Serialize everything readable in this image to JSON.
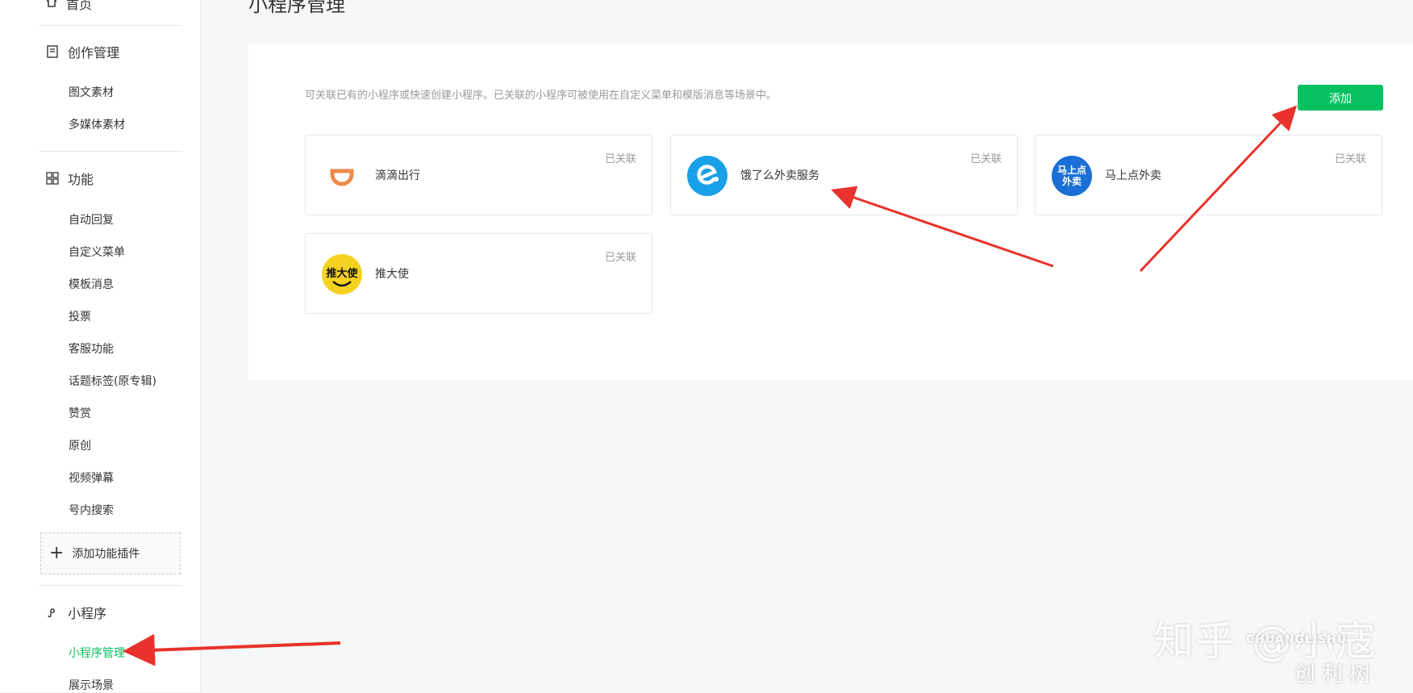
{
  "sidebar": {
    "home_label": "首页",
    "creation": {
      "title": "创作管理",
      "items": [
        "图文素材",
        "多媒体素材"
      ]
    },
    "features": {
      "title": "功能",
      "items": [
        "自动回复",
        "自定义菜单",
        "模板消息",
        "投票",
        "客服功能",
        "话题标签(原专辑)",
        "赞赏",
        "原创",
        "视频弹幕",
        "号内搜索"
      ]
    },
    "add_plugin_label": "添加功能插件",
    "miniprogram": {
      "title": "小程序",
      "items": [
        "小程序管理",
        "展示场景"
      ]
    }
  },
  "main": {
    "title": "小程序管理",
    "description": "可关联已有的小程序或快速创建小程序。已关联的小程序可被使用在自定义菜单和模版消息等场景中。",
    "add_button": "添加",
    "cards": [
      {
        "name": "滴滴出行",
        "status": "已关联",
        "logo": "didi-logo"
      },
      {
        "name": "饿了么外卖服务",
        "status": "已关联",
        "logo": "eleme-logo"
      },
      {
        "name": "马上点外卖",
        "status": "已关联",
        "logo": "mashang-logo",
        "logo_text": "马上点外卖"
      },
      {
        "name": "推大使",
        "status": "已关联",
        "logo": "tuidashi-logo",
        "logo_text": "推大使"
      }
    ]
  },
  "watermark": {
    "text": "知乎 @小寇",
    "brand_latin": "CHUANGLISHU",
    "brand_cn": "创利树"
  },
  "colors": {
    "accent": "#07c160",
    "annotation_arrow": "#e8322b"
  }
}
